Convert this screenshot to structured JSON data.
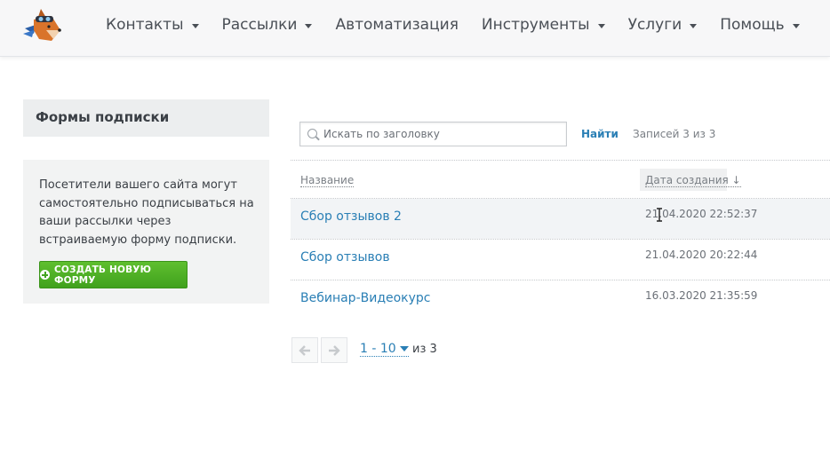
{
  "nav": {
    "items": [
      {
        "label": "Контакты",
        "has_caret": true
      },
      {
        "label": "Рассылки",
        "has_caret": true
      },
      {
        "label": "Автоматизация",
        "has_caret": false
      },
      {
        "label": "Инструменты",
        "has_caret": true
      },
      {
        "label": "Услуги",
        "has_caret": true
      },
      {
        "label": "Помощь",
        "has_caret": true
      }
    ]
  },
  "sidebar": {
    "title": "Формы подписки",
    "description": "Посетители вашего сайта могут самостоятельно подписываться на ваши рассылки через встраиваемую форму подписки.",
    "create_button": "СОЗДАТЬ НОВУЮ ФОРМУ"
  },
  "search": {
    "placeholder": "Искать по заголовку",
    "value": "",
    "find_label": "Найти",
    "records_text": "Записей 3 из 3"
  },
  "table": {
    "columns": {
      "name": "Название",
      "date": "Дата создания ↓"
    },
    "rows": [
      {
        "name": "Сбор отзывов 2",
        "date": "21.04.2020 22:52:37"
      },
      {
        "name": "Сбор отзывов",
        "date": "21.04.2020 20:22:44"
      },
      {
        "name": "Вебинар-Видеокурс",
        "date": "16.03.2020 21:35:59"
      }
    ]
  },
  "pagination": {
    "range": "1 - 10",
    "of_text": "из 3"
  },
  "icons": {
    "logo": "fox-pilot-logo",
    "search": "search-icon",
    "plus": "plus-circle-icon",
    "prev": "arrow-left-icon",
    "next": "arrow-right-icon",
    "cursor": "text-cursor-icon"
  },
  "colors": {
    "link": "#2a7fb5",
    "button_green": "#40a11d",
    "nav_text": "#4a4f56",
    "panel_bg": "#f2f3f3"
  }
}
